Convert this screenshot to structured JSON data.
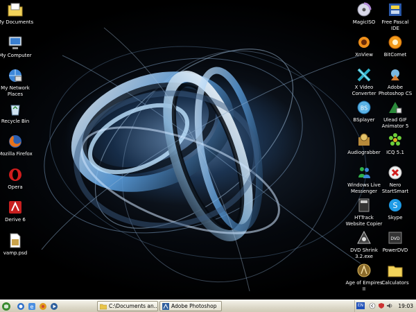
{
  "desktop": {
    "left_icons": [
      {
        "name": "my-documents",
        "label": "My Documents",
        "icon": "folder-documents-icon"
      },
      {
        "name": "my-computer",
        "label": "My Computer",
        "icon": "computer-icon"
      },
      {
        "name": "my-network-places",
        "label": "My Network\nPlaces",
        "icon": "network-icon"
      },
      {
        "name": "recycle-bin",
        "label": "Recycle Bin",
        "icon": "recycle-bin-icon"
      },
      {
        "name": "mozilla-firefox",
        "label": "Mozilla Firefox",
        "icon": "firefox-icon"
      },
      {
        "name": "opera",
        "label": "Opera",
        "icon": "opera-icon"
      },
      {
        "name": "derive-6",
        "label": "Derive 6",
        "icon": "derive-icon"
      },
      {
        "name": "vamp-psd",
        "label": "vamp.psd",
        "icon": "psd-file-icon"
      }
    ],
    "right_col1": [
      {
        "name": "magiciso",
        "label": "MagicISO",
        "icon": "disc-icon"
      },
      {
        "name": "xnview",
        "label": "XnView",
        "icon": "xnview-icon"
      },
      {
        "name": "x-video-converter",
        "label": "X Video\nConverter",
        "icon": "video-converter-icon"
      },
      {
        "name": "bsplayer",
        "label": "BSplayer",
        "icon": "bsplayer-icon"
      },
      {
        "name": "audiograbber",
        "label": "Audiograbber",
        "icon": "audiograbber-icon"
      },
      {
        "name": "windows-live-messenger",
        "label": "Windows Live\nMessenger",
        "icon": "messenger-icon"
      },
      {
        "name": "httrack",
        "label": "HTTrack\nWebsite Copier",
        "icon": "httrack-icon"
      },
      {
        "name": "dvd-shrink",
        "label": "DVD Shrink\n3.2.exe",
        "icon": "dvd-shrink-icon"
      },
      {
        "name": "age-of-empires",
        "label": "Age of Empires\nII",
        "icon": "age-of-empires-icon"
      }
    ],
    "right_col2": [
      {
        "name": "free-pascal",
        "label": "Free Pascal\nIDE",
        "icon": "pascal-icon"
      },
      {
        "name": "bitcomet",
        "label": "BitComet",
        "icon": "bitcomet-icon"
      },
      {
        "name": "adobe-photoshop",
        "label": "Adobe\nPhotoshop CS",
        "icon": "photoshop-icon"
      },
      {
        "name": "ulead-gif",
        "label": "Ulead GIF\nAnimator 5",
        "icon": "ulead-icon"
      },
      {
        "name": "icq",
        "label": "ICQ 5.1",
        "icon": "icq-flower-icon"
      },
      {
        "name": "nero",
        "label": "Nero\nStartSmart",
        "icon": "nero-icon"
      },
      {
        "name": "skype",
        "label": "Skype",
        "icon": "skype-icon"
      },
      {
        "name": "powerdvd",
        "label": "PowerDVD",
        "icon": "powerdvd-icon"
      },
      {
        "name": "calculators",
        "label": "Calculators",
        "icon": "folder-icon"
      }
    ]
  },
  "taskbar": {
    "buttons": [
      {
        "label": "C:\\Documents an...",
        "icon": "folder-icon"
      },
      {
        "label": "Adobe Photoshop",
        "icon": "photoshop-icon"
      }
    ],
    "language": "EN",
    "clock": "19:03"
  }
}
